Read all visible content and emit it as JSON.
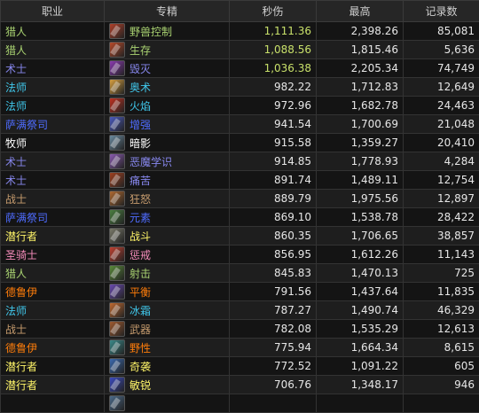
{
  "headers": {
    "class": "职业",
    "spec": "专精",
    "dps": "秒伤",
    "max": "最高",
    "records": "记录数"
  },
  "class_colors": {
    "猎人": "#a9d271",
    "术士": "#8787ed",
    "法师": "#40c7eb",
    "萨满祭司": "#4f6cff",
    "牧师": "#ffffff",
    "战士": "#c79c6e",
    "潜行者": "#fff569",
    "圣骑士": "#f58cba",
    "德鲁伊": "#ff7d0a"
  },
  "rows": [
    {
      "class": "猎人",
      "spec": "野兽控制",
      "icon": "beast-mastery-icon",
      "icon_color": "#b0402a",
      "dps": "1,111.36",
      "max": "2,398.26",
      "records": "85,081",
      "dps_color": "#c8e06a"
    },
    {
      "class": "猎人",
      "spec": "生存",
      "icon": "survival-icon",
      "icon_color": "#b84a2a",
      "dps": "1,088.56",
      "max": "1,815.46",
      "records": "5,636",
      "dps_color": "#c8e06a"
    },
    {
      "class": "术士",
      "spec": "毁灭",
      "icon": "destruction-icon",
      "icon_color": "#8a3ab0",
      "dps": "1,036.38",
      "max": "2,205.34",
      "records": "74,749",
      "dps_color": "#c8e06a"
    },
    {
      "class": "法师",
      "spec": "奥术",
      "icon": "arcane-icon",
      "icon_color": "#d8a040",
      "dps": "982.22",
      "max": "1,712.83",
      "records": "12,649",
      "dps_color": "#e6e6e6"
    },
    {
      "class": "法师",
      "spec": "火焰",
      "icon": "fire-icon",
      "icon_color": "#c03020",
      "dps": "972.96",
      "max": "1,682.78",
      "records": "24,463",
      "dps_color": "#e6e6e6"
    },
    {
      "class": "萨满祭司",
      "spec": "增强",
      "icon": "enhancement-icon",
      "icon_color": "#4a5ac0",
      "dps": "941.54",
      "max": "1,700.69",
      "records": "21,048",
      "dps_color": "#e6e6e6"
    },
    {
      "class": "牧师",
      "spec": "暗影",
      "icon": "shadow-icon",
      "icon_color": "#6a8aa0",
      "dps": "915.58",
      "max": "1,359.27",
      "records": "20,410",
      "dps_color": "#e6e6e6"
    },
    {
      "class": "术士",
      "spec": "恶魔学识",
      "icon": "demonology-icon",
      "icon_color": "#8a5ab0",
      "dps": "914.85",
      "max": "1,778.93",
      "records": "4,284",
      "dps_color": "#e6e6e6"
    },
    {
      "class": "术士",
      "spec": "痛苦",
      "icon": "affliction-icon",
      "icon_color": "#a04020",
      "dps": "891.74",
      "max": "1,489.11",
      "records": "12,754",
      "dps_color": "#e6e6e6"
    },
    {
      "class": "战士",
      "spec": "狂怒",
      "icon": "fury-icon",
      "icon_color": "#b06a30",
      "dps": "889.79",
      "max": "1,975.56",
      "records": "12,897",
      "dps_color": "#e6e6e6"
    },
    {
      "class": "萨满祭司",
      "spec": "元素",
      "icon": "elemental-icon",
      "icon_color": "#4a8040",
      "dps": "869.10",
      "max": "1,538.78",
      "records": "28,422",
      "dps_color": "#e6e6e6"
    },
    {
      "class": "潜行者",
      "spec": "战斗",
      "icon": "combat-icon",
      "icon_color": "#7a7a6a",
      "dps": "860.35",
      "max": "1,706.65",
      "records": "38,857",
      "dps_color": "#e6e6e6"
    },
    {
      "class": "圣骑士",
      "spec": "惩戒",
      "icon": "retribution-icon",
      "icon_color": "#c04030",
      "dps": "856.95",
      "max": "1,612.26",
      "records": "11,143",
      "dps_color": "#e6e6e6"
    },
    {
      "class": "猎人",
      "spec": "射击",
      "icon": "marksmanship-icon",
      "icon_color": "#5a8a3a",
      "dps": "845.83",
      "max": "1,470.13",
      "records": "725",
      "dps_color": "#e6e6e6"
    },
    {
      "class": "德鲁伊",
      "spec": "平衡",
      "icon": "balance-icon",
      "icon_color": "#6a4ab0",
      "dps": "791.56",
      "max": "1,437.64",
      "records": "11,835",
      "dps_color": "#e6e6e6"
    },
    {
      "class": "法师",
      "spec": "冰霜",
      "icon": "frost-icon",
      "icon_color": "#c06a30",
      "dps": "787.27",
      "max": "1,490.74",
      "records": "46,329",
      "dps_color": "#e6e6e6"
    },
    {
      "class": "战士",
      "spec": "武器",
      "icon": "arms-icon",
      "icon_color": "#a05a30",
      "dps": "782.08",
      "max": "1,535.29",
      "records": "12,613",
      "dps_color": "#e6e6e6"
    },
    {
      "class": "德鲁伊",
      "spec": "野性",
      "icon": "feral-icon",
      "icon_color": "#3a8a8a",
      "dps": "775.94",
      "max": "1,664.34",
      "records": "8,615",
      "dps_color": "#e6e6e6"
    },
    {
      "class": "潜行者",
      "spec": "奇袭",
      "icon": "assassination-icon",
      "icon_color": "#3a6ab0",
      "dps": "772.52",
      "max": "1,091.22",
      "records": "605",
      "dps_color": "#e6e6e6"
    },
    {
      "class": "潜行者",
      "spec": "敏锐",
      "icon": "subtlety-icon",
      "icon_color": "#3a4ac0",
      "dps": "706.76",
      "max": "1,348.17",
      "records": "946",
      "dps_color": "#e6e6e6"
    },
    {
      "class": "",
      "spec": "",
      "icon": "partial-icon",
      "icon_color": "#4a6a8a",
      "dps": "",
      "max": "",
      "records": "",
      "dps_color": "#e6e6e6"
    }
  ]
}
